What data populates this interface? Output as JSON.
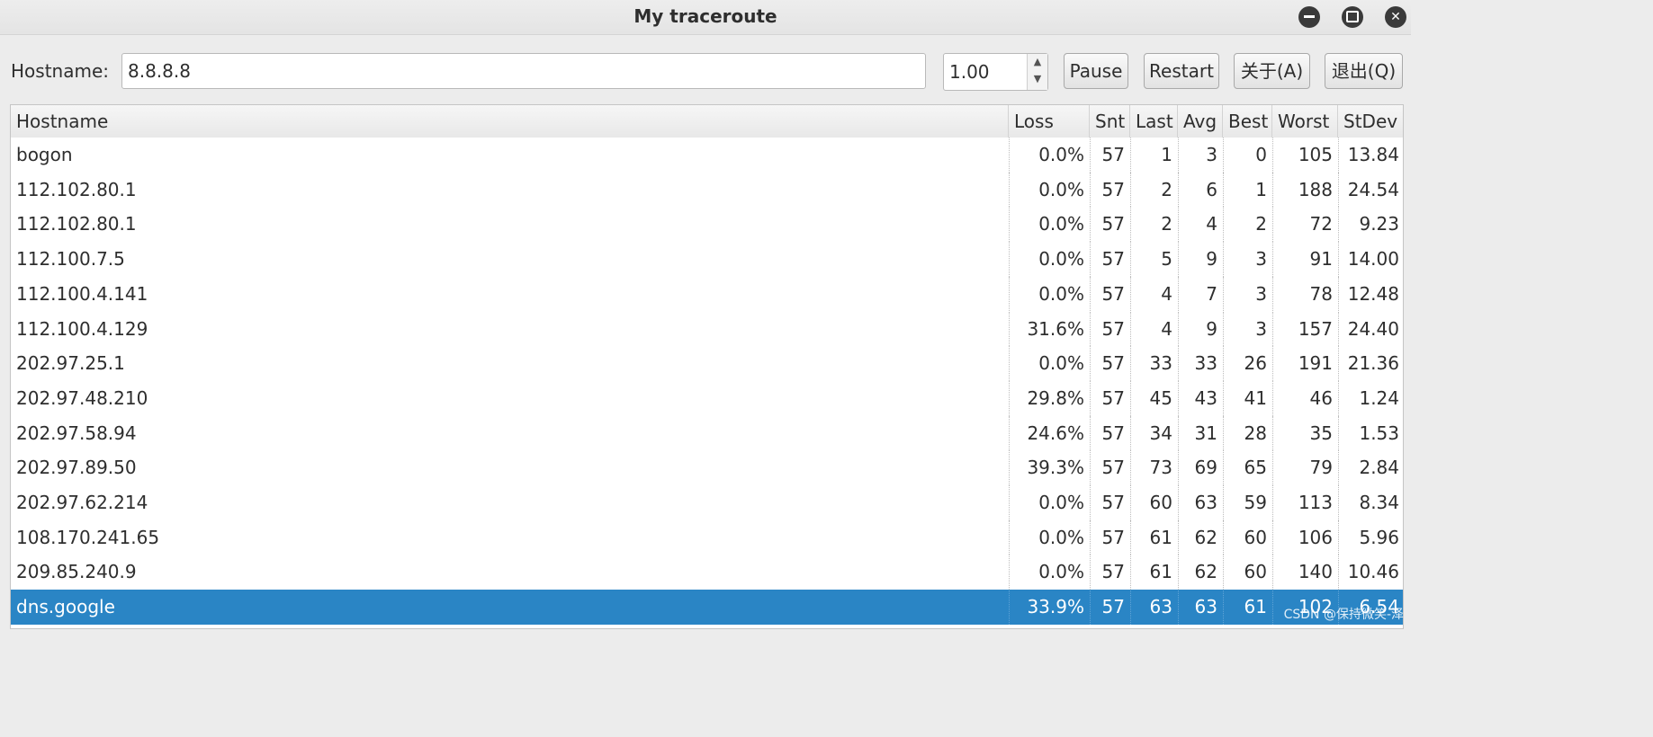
{
  "window": {
    "title": "My traceroute"
  },
  "toolbar": {
    "hostname_label": "Hostname:",
    "hostname_value": "8.8.8.8",
    "interval_value": "1.00",
    "pause_label": "Pause",
    "restart_label": "Restart",
    "about_label": "关于(A)",
    "quit_label": "退出(Q)"
  },
  "table": {
    "columns": [
      "Hostname",
      "Loss",
      "Snt",
      "Last",
      "Avg",
      "Best",
      "Worst",
      "StDev"
    ],
    "rows": [
      [
        "bogon",
        "0.0%",
        "57",
        "1",
        "3",
        "0",
        "105",
        "13.84"
      ],
      [
        "112.102.80.1",
        "0.0%",
        "57",
        "2",
        "6",
        "1",
        "188",
        "24.54"
      ],
      [
        "112.102.80.1",
        "0.0%",
        "57",
        "2",
        "4",
        "2",
        "72",
        "9.23"
      ],
      [
        "112.100.7.5",
        "0.0%",
        "57",
        "5",
        "9",
        "3",
        "91",
        "14.00"
      ],
      [
        "112.100.4.141",
        "0.0%",
        "57",
        "4",
        "7",
        "3",
        "78",
        "12.48"
      ],
      [
        "112.100.4.129",
        "31.6%",
        "57",
        "4",
        "9",
        "3",
        "157",
        "24.40"
      ],
      [
        "202.97.25.1",
        "0.0%",
        "57",
        "33",
        "33",
        "26",
        "191",
        "21.36"
      ],
      [
        "202.97.48.210",
        "29.8%",
        "57",
        "45",
        "43",
        "41",
        "46",
        "1.24"
      ],
      [
        "202.97.58.94",
        "24.6%",
        "57",
        "34",
        "31",
        "28",
        "35",
        "1.53"
      ],
      [
        "202.97.89.50",
        "39.3%",
        "57",
        "73",
        "69",
        "65",
        "79",
        "2.84"
      ],
      [
        "202.97.62.214",
        "0.0%",
        "57",
        "60",
        "63",
        "59",
        "113",
        "8.34"
      ],
      [
        "108.170.241.65",
        "0.0%",
        "57",
        "61",
        "62",
        "60",
        "106",
        "5.96"
      ],
      [
        "209.85.240.9",
        "0.0%",
        "57",
        "61",
        "62",
        "60",
        "140",
        "10.46"
      ],
      [
        "dns.google",
        "33.9%",
        "57",
        "63",
        "63",
        "61",
        "102",
        "6.54"
      ]
    ],
    "selected_row": 13
  },
  "watermark": "CSDN @保持微笑-泽"
}
